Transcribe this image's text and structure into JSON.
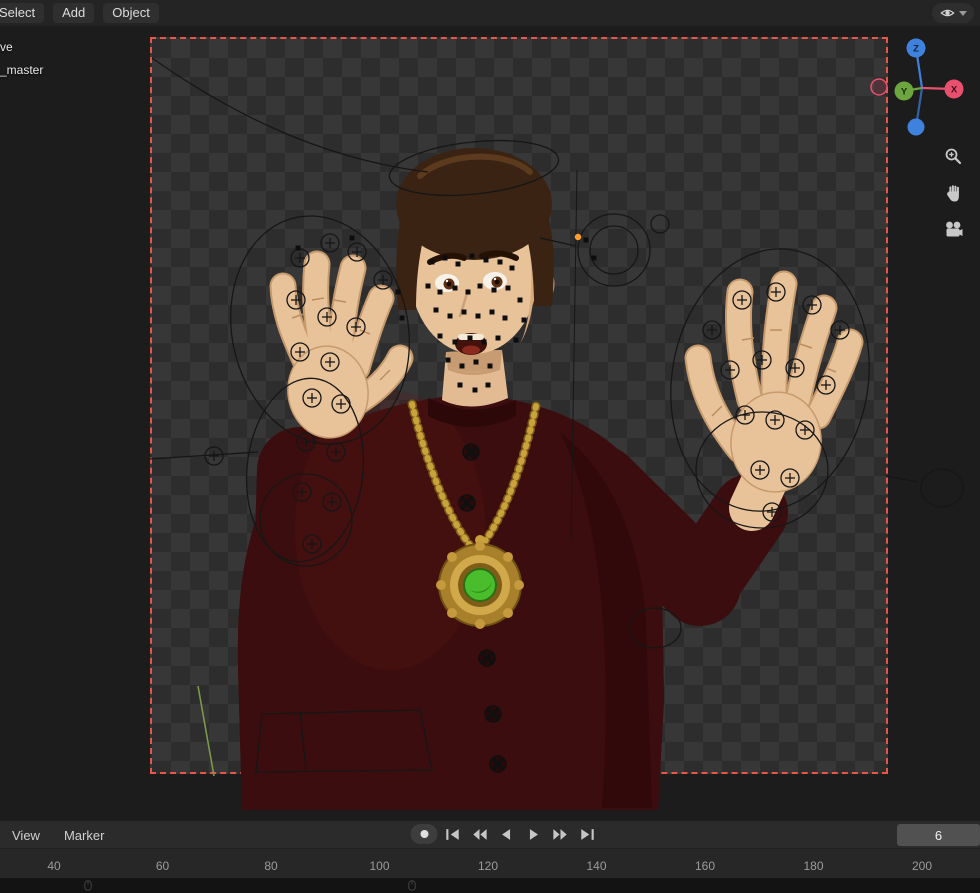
{
  "viewport_header": {
    "menus": [
      {
        "id": "select",
        "label": "Select"
      },
      {
        "id": "add",
        "label": "Add"
      },
      {
        "id": "object",
        "label": "Object"
      }
    ]
  },
  "viewport": {
    "overlay_text_lines": [
      "ve",
      "_master"
    ],
    "camera_border_color": "#e8564a",
    "gizmo": {
      "axes": [
        {
          "id": "z",
          "label": "Z",
          "color": "#3f82dd"
        },
        {
          "id": "y",
          "label": "Y",
          "color": "#6da53f"
        },
        {
          "id": "x",
          "label": "X",
          "color": "#e8516e"
        }
      ]
    },
    "tools": [
      {
        "id": "zoom",
        "icon": "magnifier-plus-icon"
      },
      {
        "id": "pan",
        "icon": "hand-icon"
      },
      {
        "id": "camera-view",
        "icon": "movie-camera-icon"
      }
    ],
    "visibility_dropdown_icon": "eye-icon"
  },
  "timeline": {
    "menus": [
      {
        "id": "view",
        "label": "View"
      },
      {
        "id": "marker",
        "label": "Marker"
      }
    ],
    "transport": [
      "auto-key-record",
      "jump-to-start",
      "previous-keyframe",
      "play-reverse",
      "play-forward",
      "next-keyframe",
      "jump-to-end"
    ],
    "frame_field": {
      "value": "6"
    },
    "ruler_ticks": [
      "40",
      "60",
      "80",
      "100",
      "120",
      "140",
      "160",
      "180",
      "200"
    ]
  },
  "colors": {
    "accent_red": "#e8564a",
    "axis_x": "#e8516e",
    "axis_y": "#6da53f",
    "axis_z": "#3f82dd",
    "sweater_maroon": "#3c0d0e",
    "skin": "#e8c39a",
    "hair_brown": "#3a2313",
    "gold": "#c9a23c",
    "amulet_green": "#49bd2c"
  }
}
